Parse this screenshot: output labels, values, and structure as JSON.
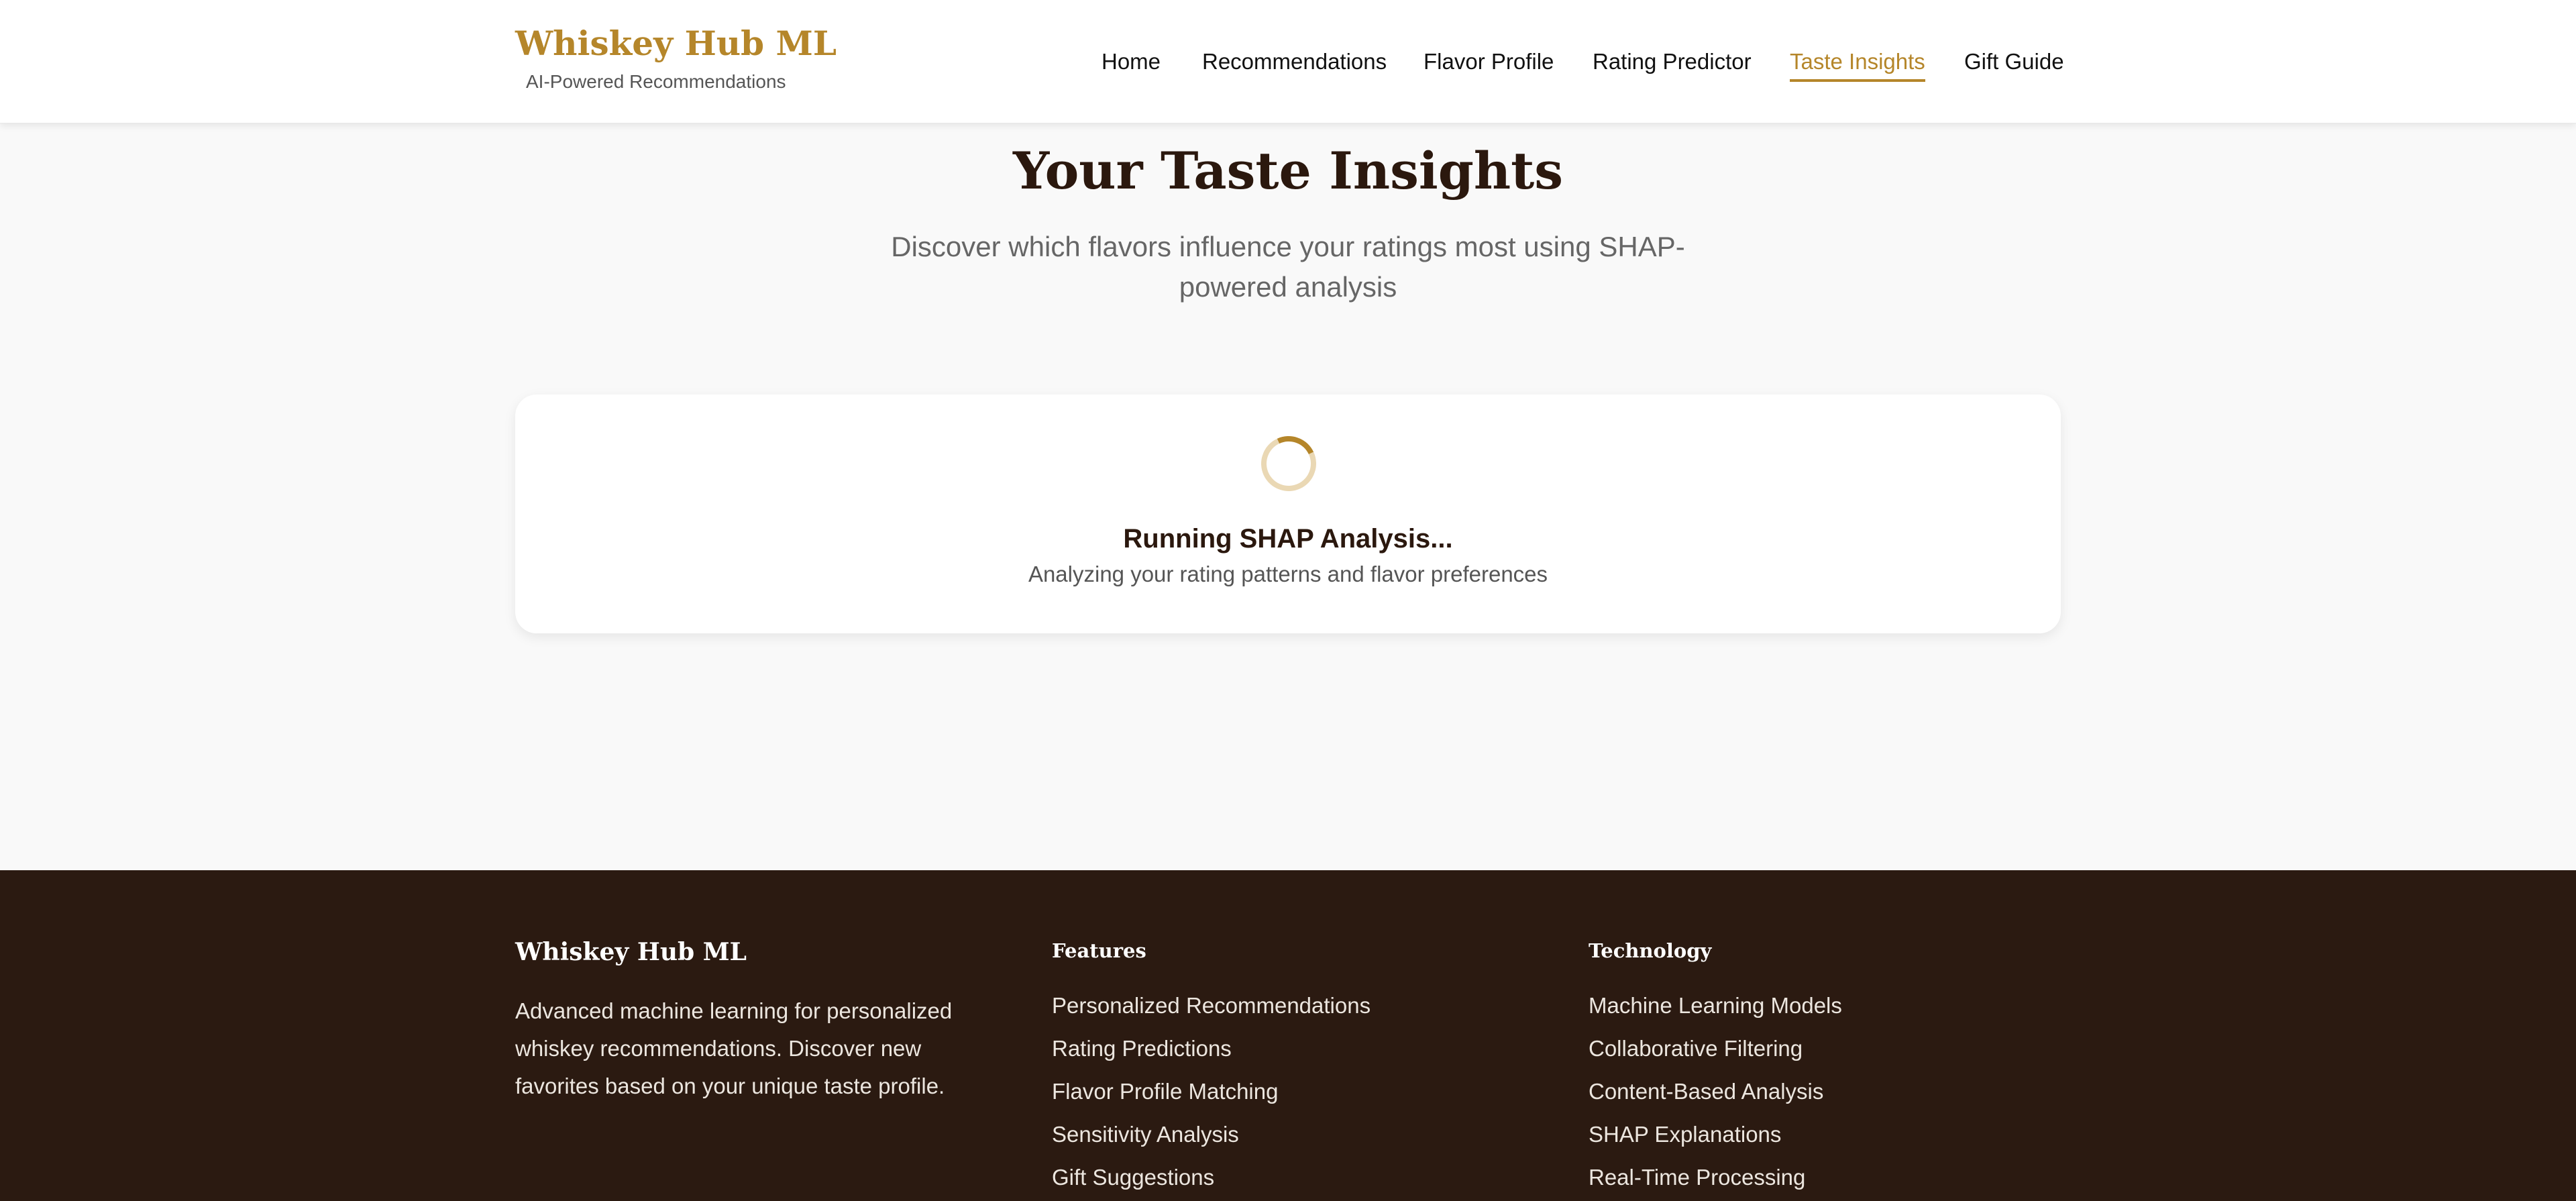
{
  "header": {
    "brand_title": "Whiskey Hub ML",
    "brand_subtitle": "AI-Powered Recommendations",
    "nav": [
      {
        "label": "Home",
        "active": false
      },
      {
        "label": "Recommendations",
        "active": false
      },
      {
        "label": "Flavor Profile",
        "active": false
      },
      {
        "label": "Rating Predictor",
        "active": false
      },
      {
        "label": "Taste Insights",
        "active": true
      },
      {
        "label": "Gift Guide",
        "active": false
      }
    ]
  },
  "hero": {
    "title": "Your Taste Insights",
    "subtitle": "Discover which flavors influence your ratings most using SHAP-powered analysis"
  },
  "loading": {
    "title": "Running SHAP Analysis...",
    "message": "Analyzing your rating patterns and flavor preferences",
    "icon": "spinner-icon"
  },
  "footer": {
    "brand": "Whiskey Hub ML",
    "description": "Advanced machine learning for personalized whiskey recommendations. Discover new favorites based on your unique taste profile.",
    "features": {
      "heading": "Features",
      "items": [
        "Personalized Recommendations",
        "Rating Predictions",
        "Flavor Profile Matching",
        "Sensitivity Analysis",
        "Gift Suggestions"
      ]
    },
    "technology": {
      "heading": "Technology",
      "items": [
        "Machine Learning Models",
        "Collaborative Filtering",
        "Content-Based Analysis",
        "SHAP Explanations",
        "Real-Time Processing"
      ]
    }
  },
  "colors": {
    "accent": "#b5862a",
    "dark_brown": "#2b180e",
    "footer_bg": "#2b1a11",
    "page_bg": "#f9f9f9"
  }
}
